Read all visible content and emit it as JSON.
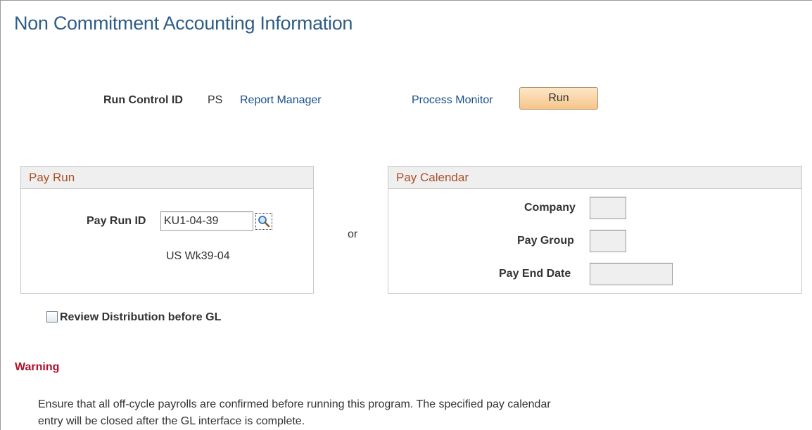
{
  "page": {
    "title": "Non Commitment Accounting Information"
  },
  "run_control": {
    "label": "Run Control ID",
    "value": "PS",
    "report_manager_link": "Report Manager",
    "process_monitor_link": "Process Monitor",
    "run_button": "Run"
  },
  "pay_run": {
    "header": "Pay Run",
    "pay_run_id_label": "Pay Run ID",
    "pay_run_id_value": "KU1-04-39",
    "lookup_icon": "magnifier-icon",
    "description": "US Wk39-04"
  },
  "separator": {
    "text": "or"
  },
  "pay_calendar": {
    "header": "Pay Calendar",
    "company_label": "Company",
    "company_value": "",
    "pay_group_label": "Pay Group",
    "pay_group_value": "",
    "pay_end_date_label": "Pay End Date",
    "pay_end_date_value": ""
  },
  "review": {
    "label": "Review Distribution before GL",
    "checked": false
  },
  "warning": {
    "title": "Warning",
    "line1": "Ensure that all off-cycle payrolls are confirmed before running this program. The specified pay calendar",
    "line2": "entry will be closed after the GL interface is complete."
  },
  "colors": {
    "title": "#305d86",
    "link": "#1b4f8a",
    "group_header_text": "#a8502a",
    "warning": "#b0102a",
    "run_button": "#f6c58a"
  }
}
